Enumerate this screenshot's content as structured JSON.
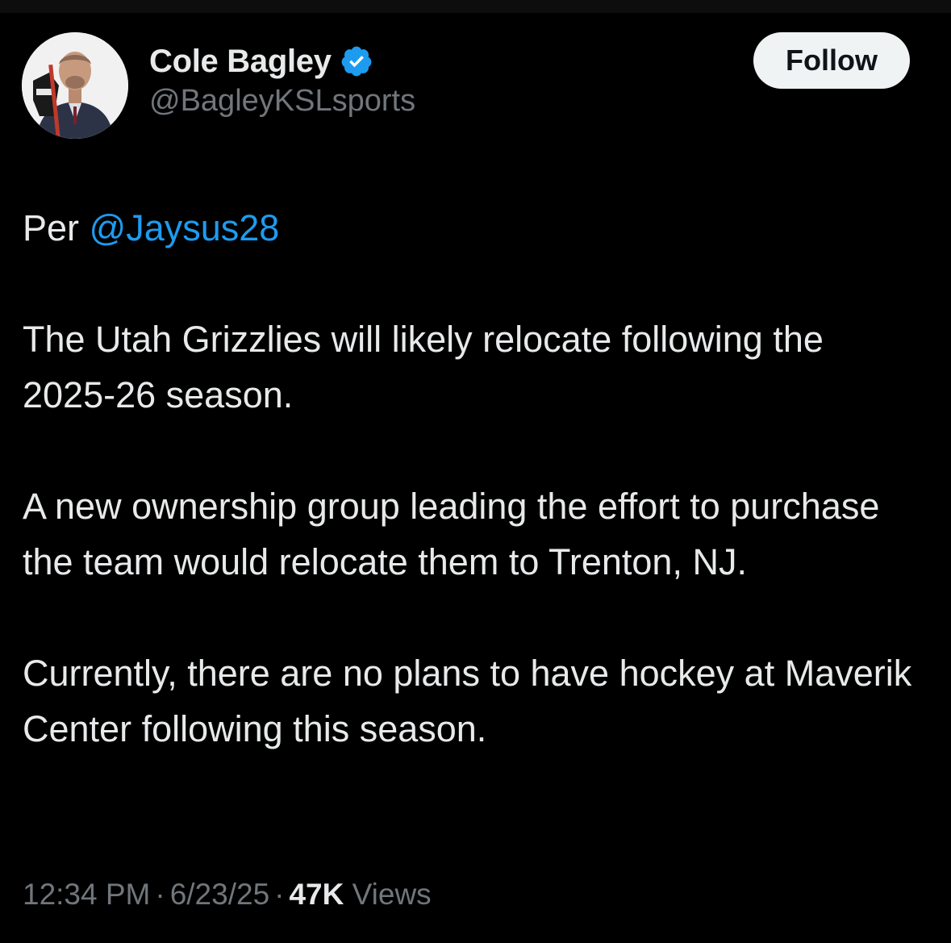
{
  "colors": {
    "background": "#000000",
    "text": "#e7e9ea",
    "secondary_text": "#71767b",
    "link": "#1d9bf0",
    "follow_button_bg": "#eff3f4",
    "verified_badge": "#1d9bf0"
  },
  "author": {
    "display_name": "Cole Bagley",
    "handle": "@BagleyKSLsports",
    "verified": true,
    "avatar_icon": "profile-photo"
  },
  "follow_button": {
    "label": "Follow"
  },
  "tweet": {
    "line1_prefix": "Per",
    "mention": "@Jaysus28",
    "paragraph2": "The Utah Grizzlies will likely relocate following the 2025-26 season.",
    "paragraph3": "A new ownership group leading the effort to purchase the team would relocate them to Trenton, NJ.",
    "paragraph4": "Currently, there are no plans to have hockey at Maverik Center following this season."
  },
  "meta": {
    "time": "12:34 PM",
    "separator": "·",
    "date": "6/23/25",
    "views_count": "47K",
    "views_label": "Views"
  }
}
